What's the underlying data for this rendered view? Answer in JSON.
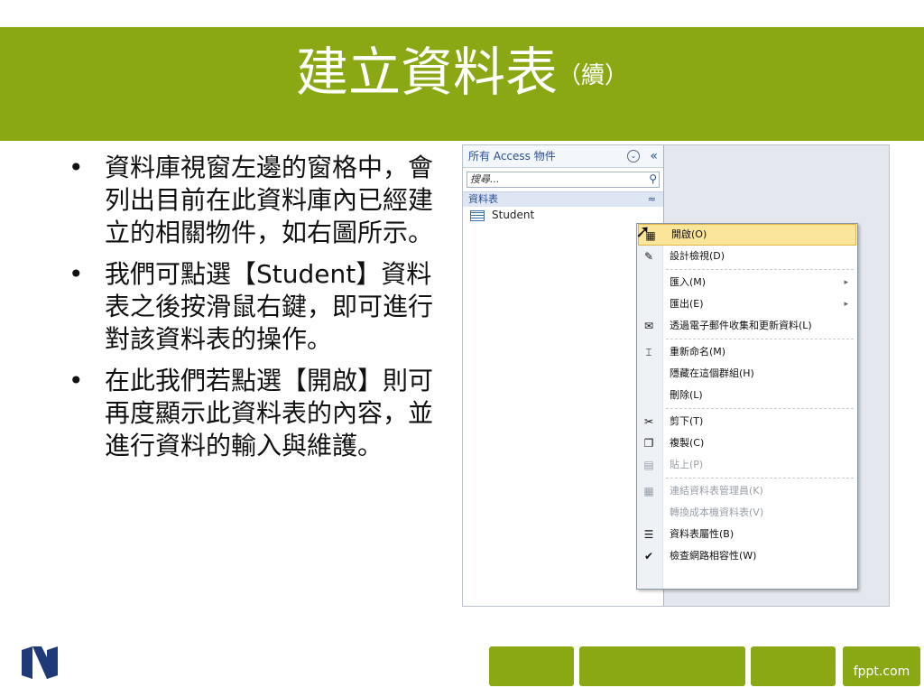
{
  "colors": {
    "accent": "#8aa813",
    "menu_highlight": "#fbe59b"
  },
  "slide": {
    "title": "建立資料表",
    "title_sub": "（續）",
    "bullets": [
      "資料庫視窗左邊的窗格中，會列出目前在此資料庫內已經建立的相關物件，如右圖所示。",
      "我們可點選【Student】資料表之後按滑鼠右鍵，即可進行對該資料表的操作。",
      "在此我們若點選【開啟】則可再度顯示此資料表的內容，並進行資料的輸入與維護。"
    ],
    "bullet_char": "•",
    "footer_brand": "fppt.com"
  },
  "nav_pane": {
    "header": "所有 Access 物件",
    "header_dropdown_icon": "⌄",
    "header_collapse_icon": "«",
    "search_placeholder": "搜尋...",
    "search_icon": "⚲",
    "group_label": "資料表",
    "group_chevron": "≈",
    "items": [
      {
        "label": "Student",
        "icon": "table-icon"
      }
    ]
  },
  "context_menu": {
    "items": [
      {
        "label": "開啟(O)",
        "icon": "open-icon",
        "glyph": "▦",
        "state": "selected"
      },
      {
        "label": "設計檢視(D)",
        "icon": "design-view-icon",
        "glyph": "✎",
        "state": "normal"
      },
      {
        "label": "匯入(M)",
        "icon": "",
        "glyph": "",
        "state": "normal",
        "submenu": "▸"
      },
      {
        "label": "匯出(E)",
        "icon": "",
        "glyph": "",
        "state": "normal",
        "submenu": "▸"
      },
      {
        "label": "透過電子郵件收集和更新資料(L)",
        "icon": "email-icon",
        "glyph": "✉",
        "state": "normal"
      },
      {
        "label": "重新命名(M)",
        "icon": "rename-icon",
        "glyph": "⌶",
        "state": "normal"
      },
      {
        "label": "隱藏在這個群組(H)",
        "icon": "",
        "glyph": "",
        "state": "normal"
      },
      {
        "label": "刪除(L)",
        "icon": "",
        "glyph": "",
        "state": "normal"
      },
      {
        "label": "剪下(T)",
        "icon": "scissors-icon",
        "glyph": "✂",
        "state": "normal"
      },
      {
        "label": "複製(C)",
        "icon": "copy-icon",
        "glyph": "❐",
        "state": "normal"
      },
      {
        "label": "貼上(P)",
        "icon": "paste-icon",
        "glyph": "▤",
        "state": "disabled"
      },
      {
        "label": "連結資料表管理員(K)",
        "icon": "linked-table-icon",
        "glyph": "▦",
        "state": "disabled"
      },
      {
        "label": "轉換成本機資料表(V)",
        "icon": "",
        "glyph": "",
        "state": "disabled"
      },
      {
        "label": "資料表屬性(B)",
        "icon": "properties-icon",
        "glyph": "☰",
        "state": "normal"
      },
      {
        "label": "檢查網路相容性(W)",
        "icon": "web-check-icon",
        "glyph": "✔",
        "state": "normal"
      }
    ]
  }
}
